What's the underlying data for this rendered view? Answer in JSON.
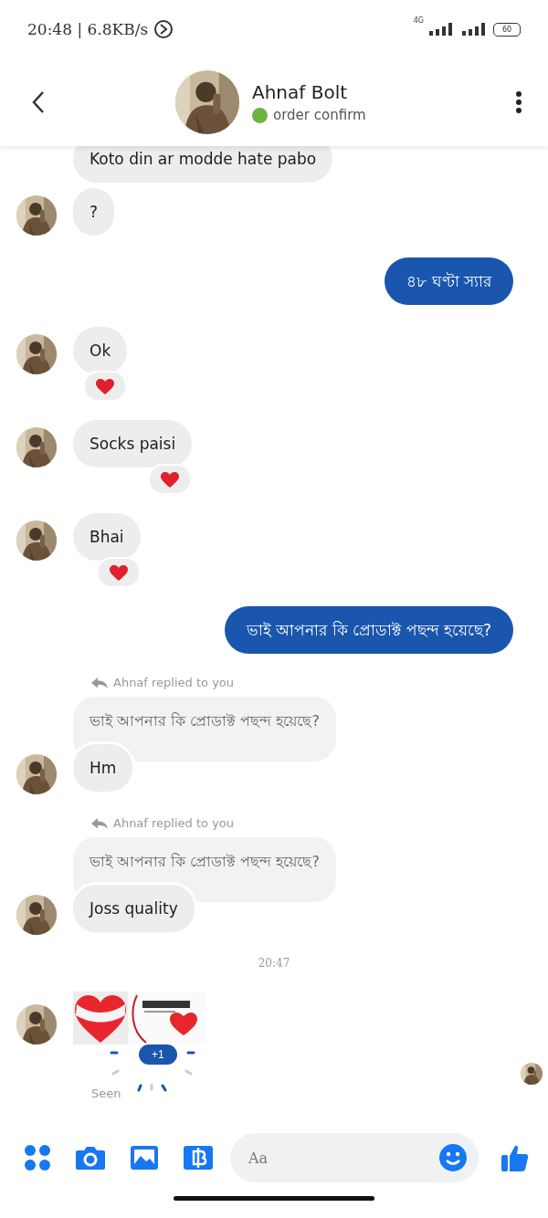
{
  "status_bar": {
    "time": "20:48 | 6.8KB/s",
    "network": "4G",
    "battery": "60"
  },
  "header": {
    "name": "Ahnaf Bolt",
    "status": "order confirm",
    "online": true
  },
  "messages": [
    {
      "kind": "incoming",
      "text": "Koto din ar modde hate pabo",
      "avatar": false,
      "reaction": false
    },
    {
      "kind": "incoming",
      "text": "?",
      "avatar": true,
      "reaction": false
    },
    {
      "kind": "outgoing",
      "text": "৪৮ ঘণ্টা স্যার"
    },
    {
      "kind": "incoming",
      "text": "Ok",
      "avatar": true,
      "reaction": true
    },
    {
      "kind": "incoming",
      "text": "Socks paisi",
      "avatar": true,
      "reaction": true
    },
    {
      "kind": "incoming",
      "text": "Bhai",
      "avatar": true,
      "reaction": true
    },
    {
      "kind": "outgoing",
      "text": "ভাই আপনার কি প্রোডাক্ট পছন্দ হয়েছে?"
    },
    {
      "kind": "reply",
      "label": "Ahnaf replied to you",
      "quote": "ভাই আপনার কি প্রোডাক্ট পছন্দ হয়েছে?",
      "text": "Hm",
      "avatar": true
    },
    {
      "kind": "reply",
      "label": "Ahnaf replied to you",
      "quote": "ভাই আপনার কি প্রোডাক্ট পছন্দ হয়েছে?",
      "text": "Joss quality",
      "avatar": true
    },
    {
      "kind": "timestamp",
      "text": "20:47"
    },
    {
      "kind": "sticker",
      "avatar": true,
      "badge": "+1",
      "seen": "Seen",
      "seen_avatar": true
    }
  ],
  "composer": {
    "placeholder": "Aa"
  }
}
